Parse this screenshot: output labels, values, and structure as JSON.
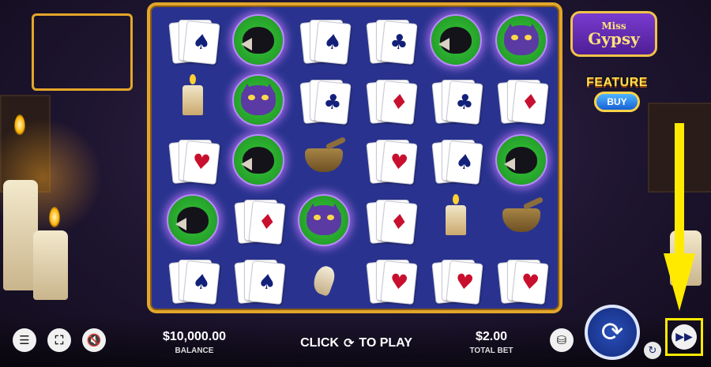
{
  "game": {
    "logo_line1": "Miss",
    "logo_line2": "Gypsy"
  },
  "feature_buy": {
    "title": "FEATURE",
    "button_label": "BUY"
  },
  "reels": {
    "rows": [
      [
        "spade-cards",
        "crow",
        "spade-cards",
        "club-cards",
        "crow",
        "cat"
      ],
      [
        "candle",
        "cat",
        "club-cards",
        "diamond-cards",
        "club-cards",
        "diamond-cards"
      ],
      [
        "heart-cards",
        "crow",
        "mortar",
        "heart-cards",
        "spade-cards",
        "crow"
      ],
      [
        "crow",
        "diamond-cards",
        "cat",
        "diamond-cards",
        "candle",
        "mortar"
      ],
      [
        "spade-cards",
        "spade-cards",
        "tooth",
        "heart-cards",
        "heart-cards",
        "heart-cards"
      ]
    ]
  },
  "controls": {
    "menu_icon": "menu-icon",
    "fullscreen_icon": "fullscreen-icon",
    "mute_icon": "sound-muted-icon",
    "balance_value": "$10,000.00",
    "balance_label": "BALANCE",
    "play_prompt_left": "CLICK",
    "play_prompt_right": "TO PLAY",
    "total_bet_value": "$2.00",
    "total_bet_label": "TOTAL BET",
    "bet_icon": "chip-stack-icon",
    "spin_icon": "spin-icon",
    "autoplay_icon": "autoplay-icon",
    "turbo_icon": "fast-forward-icon"
  },
  "colors": {
    "frame_gold": "#e2a62b",
    "reel_bg": "#29338f",
    "highlight_yellow": "#ffea00"
  }
}
